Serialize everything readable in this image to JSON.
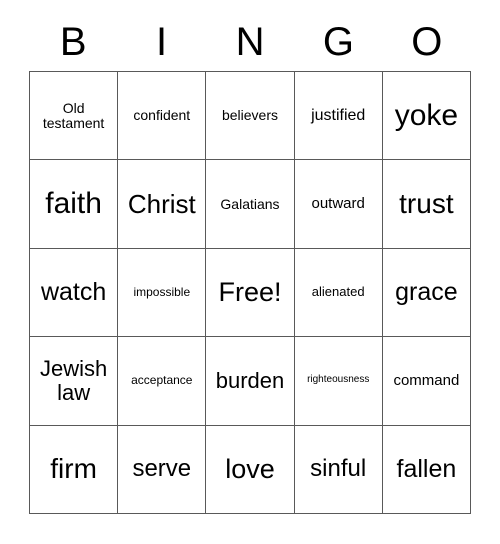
{
  "card": {
    "title": "BINGO",
    "background_color": "#ffffff",
    "border_color": "#595959",
    "text_color": "#000000"
  },
  "header": {
    "letters": [
      {
        "label": "B"
      },
      {
        "label": "I"
      },
      {
        "label": "N"
      },
      {
        "label": "G"
      },
      {
        "label": "O"
      }
    ]
  },
  "grid": {
    "columns": 5,
    "rows": 5,
    "free_space": {
      "row": 3,
      "column": 3,
      "label": "Free!"
    },
    "cells": [
      [
        {
          "label": "Old testament",
          "size": "fs-m"
        },
        {
          "label": "confident",
          "size": "fs-m"
        },
        {
          "label": "believers",
          "size": "fs-m"
        },
        {
          "label": "justified",
          "size": "fs-l"
        },
        {
          "label": "yoke",
          "size": "fs-7xl"
        }
      ],
      [
        {
          "label": "faith",
          "size": "fs-7xl"
        },
        {
          "label": "Christ",
          "size": "fs-4xl"
        },
        {
          "label": "Galatians",
          "size": "fs-m"
        },
        {
          "label": "outward",
          "size": "fs-ml"
        },
        {
          "label": "trust",
          "size": "fs-6xl"
        }
      ],
      [
        {
          "label": "watch",
          "size": "fs-3xl"
        },
        {
          "label": "impossible",
          "size": "fs-xs"
        },
        {
          "label": "Free!",
          "size": "fs-5xl"
        },
        {
          "label": "alienated",
          "size": "fs-s"
        },
        {
          "label": "grace",
          "size": "fs-3xl"
        }
      ],
      [
        {
          "label": "Jewish law",
          "size": "fs-xl"
        },
        {
          "label": "acceptance",
          "size": "fs-xs"
        },
        {
          "label": "burden",
          "size": "fs-xl"
        },
        {
          "label": "righteousness",
          "size": "fs-xxs"
        },
        {
          "label": "command",
          "size": "fs-ml"
        }
      ],
      [
        {
          "label": "firm",
          "size": "fs-6xl"
        },
        {
          "label": "serve",
          "size": "fs-xxl"
        },
        {
          "label": "love",
          "size": "fs-5xl"
        },
        {
          "label": "sinful",
          "size": "fs-xxl"
        },
        {
          "label": "fallen",
          "size": "fs-3xl"
        }
      ]
    ]
  }
}
